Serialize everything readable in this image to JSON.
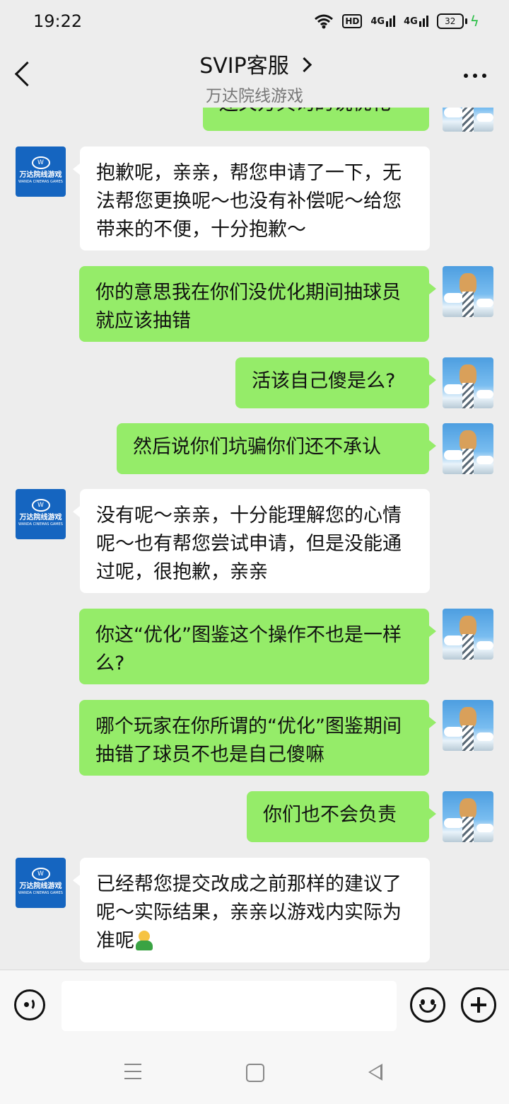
{
  "status": {
    "time": "19:22",
    "hd": "HD",
    "net1": "4G",
    "net2": "4G",
    "battery": "32"
  },
  "header": {
    "title": "SVIP客服",
    "subtitle": "万达院线游戏"
  },
  "cs_avatar": {
    "cn": "万达院线游戏",
    "en": "WANDA CINEMAS GAMES"
  },
  "messages": [
    {
      "side": "out",
      "text": "还关方具询的说优化"
    },
    {
      "side": "in",
      "text": "抱歉呢，亲亲，帮您申请了一下，无法帮您更换呢～也没有补偿呢～给您带来的不便，十分抱歉～"
    },
    {
      "side": "out",
      "text": "你的意思我在你们没优化期间抽球员就应该抽错"
    },
    {
      "side": "out",
      "text": "活该自己傻是么?"
    },
    {
      "side": "out",
      "text": "然后说你们坑骗你们还不承认"
    },
    {
      "side": "in",
      "text": "没有呢～亲亲，十分能理解您的心情呢～也有帮您尝试申请，但是没能通过呢，很抱歉，亲亲"
    },
    {
      "side": "out",
      "text": "你这“优化”图鉴这个操作不也是一样么?"
    },
    {
      "side": "out",
      "text": "哪个玩家在你所谓的“优化”图鉴期间抽错了球员不也是自己傻嘛"
    },
    {
      "side": "out",
      "text": "你们也不会负责"
    },
    {
      "side": "in",
      "text": "已经帮您提交改成之前那样的建议了呢～实际结果，亲亲以游戏内实际为准呢",
      "emoji": "person-emoji"
    }
  ],
  "input": {
    "value": "",
    "placeholder": ""
  },
  "icons": {
    "voice": "voice-icon",
    "emoji": "emoji-icon",
    "plus": "plus-icon"
  },
  "colors": {
    "outgoing_bubble": "#95ec69",
    "incoming_bubble": "#ffffff",
    "background": "#ededed",
    "cs_avatar": "#1565c0"
  }
}
